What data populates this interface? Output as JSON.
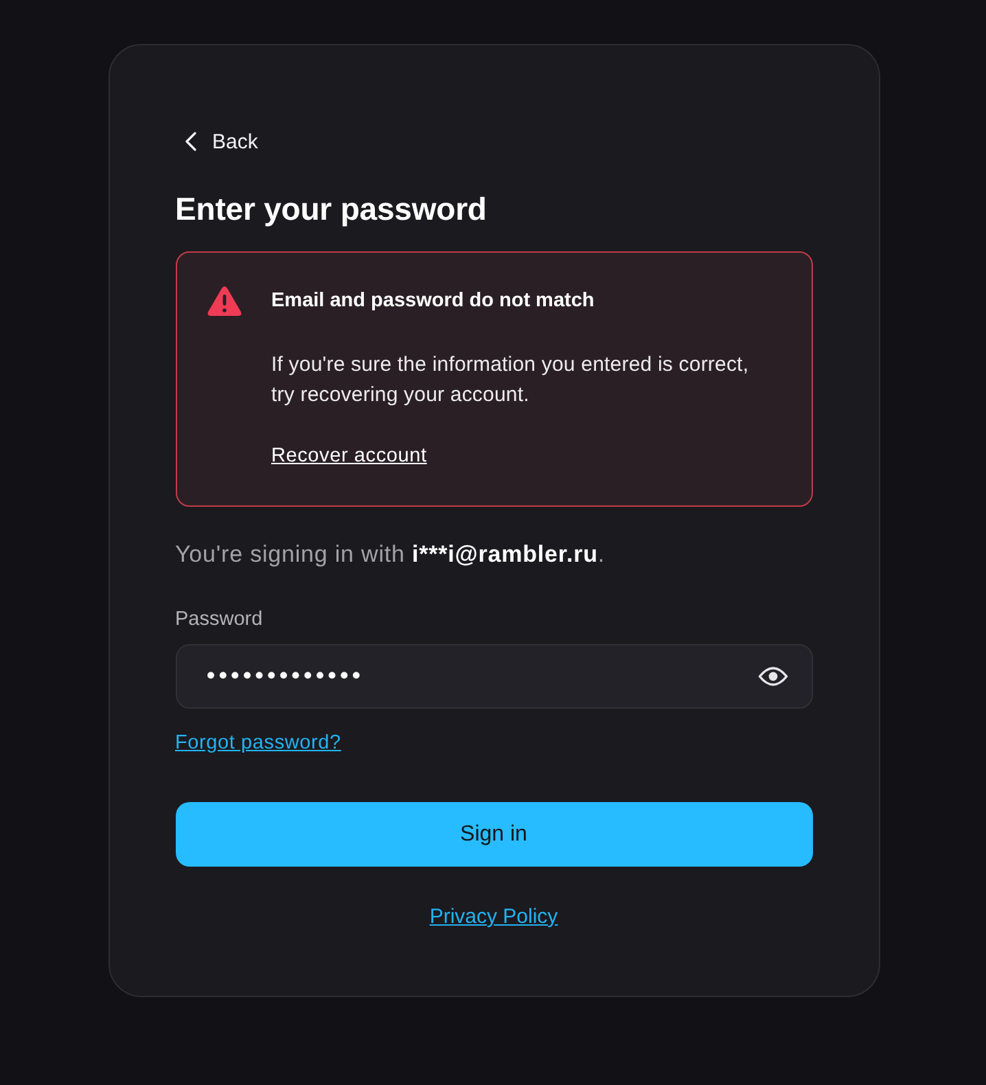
{
  "back": {
    "label": "Back"
  },
  "title": "Enter your password",
  "alert": {
    "title": "Email and password do not match",
    "message": "If you're sure the information you entered is correct, try recovering your account.",
    "link": "Recover account"
  },
  "signin_notice": {
    "prefix": "You're signing in with",
    "email": "i***i@rambler.ru",
    "suffix": "."
  },
  "password_field": {
    "label": "Password",
    "value": "•••••••••••••"
  },
  "forgot_link": "Forgot password?",
  "submit_button": "Sign in",
  "privacy_link": "Privacy Policy"
}
